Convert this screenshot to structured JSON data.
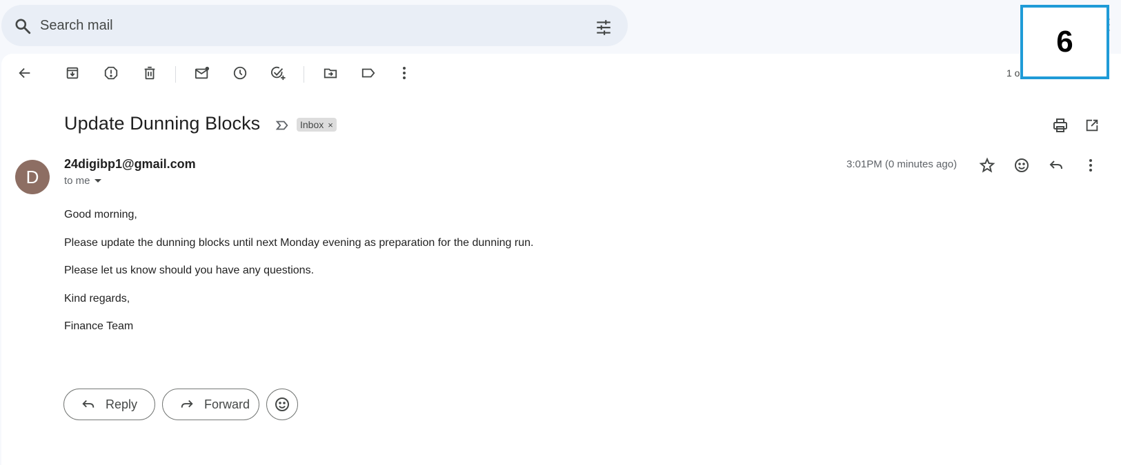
{
  "search": {
    "placeholder": "Search mail"
  },
  "toolbar": {
    "icons": [
      "back-arrow-icon",
      "archive-icon",
      "report-spam-icon",
      "delete-icon",
      "mark-unread-icon",
      "snooze-icon",
      "add-to-tasks-icon",
      "move-to-icon",
      "labels-icon",
      "more-vert-icon"
    ],
    "count": "1 o"
  },
  "email": {
    "subject": "Update Dunning Blocks",
    "label": "Inbox",
    "label_remove": "×",
    "avatar_letter": "D",
    "sender": "24digibp1@gmail.com",
    "recipient": "to me",
    "time": "3:01PM (0 minutes ago)",
    "body": [
      "Good morning,",
      "Please update the dunning blocks until next Monday evening as preparation for the dunning run.",
      "Please let us know should you have any questions.",
      "Kind regards,",
      "Finance Team"
    ]
  },
  "actions": {
    "reply": "Reply",
    "forward": "Forward"
  },
  "badge": {
    "number": "6",
    "border_color": "#1f9bd7"
  },
  "colors": {
    "avatar": "#8d6e63",
    "search_bg": "#e9eef6",
    "page_bg": "#f6f8fc"
  }
}
